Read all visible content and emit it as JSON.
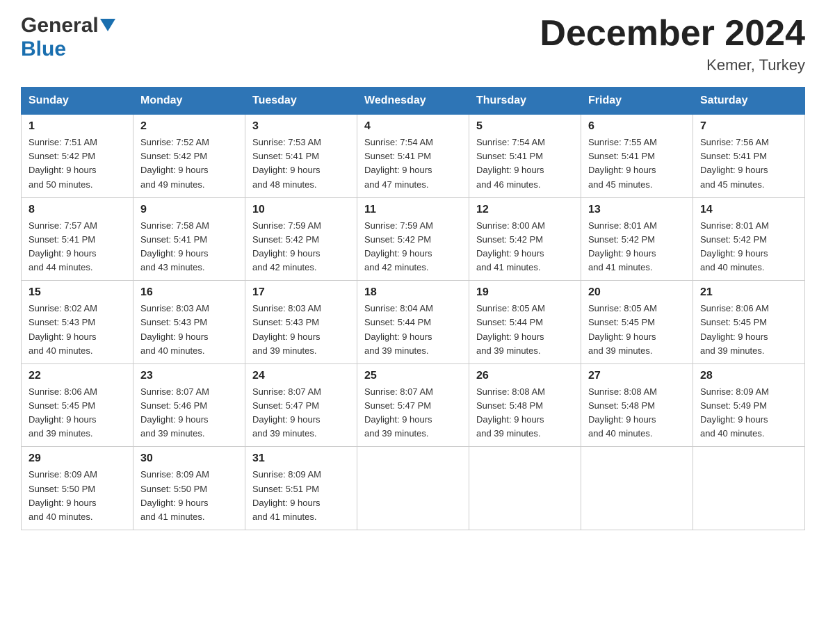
{
  "logo": {
    "general": "General",
    "blue": "Blue"
  },
  "title": "December 2024",
  "subtitle": "Kemer, Turkey",
  "weekdays": [
    "Sunday",
    "Monday",
    "Tuesday",
    "Wednesday",
    "Thursday",
    "Friday",
    "Saturday"
  ],
  "weeks": [
    [
      {
        "day": "1",
        "sunrise": "7:51 AM",
        "sunset": "5:42 PM",
        "daylight": "9 hours and 50 minutes."
      },
      {
        "day": "2",
        "sunrise": "7:52 AM",
        "sunset": "5:42 PM",
        "daylight": "9 hours and 49 minutes."
      },
      {
        "day": "3",
        "sunrise": "7:53 AM",
        "sunset": "5:41 PM",
        "daylight": "9 hours and 48 minutes."
      },
      {
        "day": "4",
        "sunrise": "7:54 AM",
        "sunset": "5:41 PM",
        "daylight": "9 hours and 47 minutes."
      },
      {
        "day": "5",
        "sunrise": "7:54 AM",
        "sunset": "5:41 PM",
        "daylight": "9 hours and 46 minutes."
      },
      {
        "day": "6",
        "sunrise": "7:55 AM",
        "sunset": "5:41 PM",
        "daylight": "9 hours and 45 minutes."
      },
      {
        "day": "7",
        "sunrise": "7:56 AM",
        "sunset": "5:41 PM",
        "daylight": "9 hours and 45 minutes."
      }
    ],
    [
      {
        "day": "8",
        "sunrise": "7:57 AM",
        "sunset": "5:41 PM",
        "daylight": "9 hours and 44 minutes."
      },
      {
        "day": "9",
        "sunrise": "7:58 AM",
        "sunset": "5:41 PM",
        "daylight": "9 hours and 43 minutes."
      },
      {
        "day": "10",
        "sunrise": "7:59 AM",
        "sunset": "5:42 PM",
        "daylight": "9 hours and 42 minutes."
      },
      {
        "day": "11",
        "sunrise": "7:59 AM",
        "sunset": "5:42 PM",
        "daylight": "9 hours and 42 minutes."
      },
      {
        "day": "12",
        "sunrise": "8:00 AM",
        "sunset": "5:42 PM",
        "daylight": "9 hours and 41 minutes."
      },
      {
        "day": "13",
        "sunrise": "8:01 AM",
        "sunset": "5:42 PM",
        "daylight": "9 hours and 41 minutes."
      },
      {
        "day": "14",
        "sunrise": "8:01 AM",
        "sunset": "5:42 PM",
        "daylight": "9 hours and 40 minutes."
      }
    ],
    [
      {
        "day": "15",
        "sunrise": "8:02 AM",
        "sunset": "5:43 PM",
        "daylight": "9 hours and 40 minutes."
      },
      {
        "day": "16",
        "sunrise": "8:03 AM",
        "sunset": "5:43 PM",
        "daylight": "9 hours and 40 minutes."
      },
      {
        "day": "17",
        "sunrise": "8:03 AM",
        "sunset": "5:43 PM",
        "daylight": "9 hours and 39 minutes."
      },
      {
        "day": "18",
        "sunrise": "8:04 AM",
        "sunset": "5:44 PM",
        "daylight": "9 hours and 39 minutes."
      },
      {
        "day": "19",
        "sunrise": "8:05 AM",
        "sunset": "5:44 PM",
        "daylight": "9 hours and 39 minutes."
      },
      {
        "day": "20",
        "sunrise": "8:05 AM",
        "sunset": "5:45 PM",
        "daylight": "9 hours and 39 minutes."
      },
      {
        "day": "21",
        "sunrise": "8:06 AM",
        "sunset": "5:45 PM",
        "daylight": "9 hours and 39 minutes."
      }
    ],
    [
      {
        "day": "22",
        "sunrise": "8:06 AM",
        "sunset": "5:45 PM",
        "daylight": "9 hours and 39 minutes."
      },
      {
        "day": "23",
        "sunrise": "8:07 AM",
        "sunset": "5:46 PM",
        "daylight": "9 hours and 39 minutes."
      },
      {
        "day": "24",
        "sunrise": "8:07 AM",
        "sunset": "5:47 PM",
        "daylight": "9 hours and 39 minutes."
      },
      {
        "day": "25",
        "sunrise": "8:07 AM",
        "sunset": "5:47 PM",
        "daylight": "9 hours and 39 minutes."
      },
      {
        "day": "26",
        "sunrise": "8:08 AM",
        "sunset": "5:48 PM",
        "daylight": "9 hours and 39 minutes."
      },
      {
        "day": "27",
        "sunrise": "8:08 AM",
        "sunset": "5:48 PM",
        "daylight": "9 hours and 40 minutes."
      },
      {
        "day": "28",
        "sunrise": "8:09 AM",
        "sunset": "5:49 PM",
        "daylight": "9 hours and 40 minutes."
      }
    ],
    [
      {
        "day": "29",
        "sunrise": "8:09 AM",
        "sunset": "5:50 PM",
        "daylight": "9 hours and 40 minutes."
      },
      {
        "day": "30",
        "sunrise": "8:09 AM",
        "sunset": "5:50 PM",
        "daylight": "9 hours and 41 minutes."
      },
      {
        "day": "31",
        "sunrise": "8:09 AM",
        "sunset": "5:51 PM",
        "daylight": "9 hours and 41 minutes."
      },
      null,
      null,
      null,
      null
    ]
  ],
  "labels": {
    "sunrise": "Sunrise:",
    "sunset": "Sunset:",
    "daylight": "Daylight:"
  }
}
